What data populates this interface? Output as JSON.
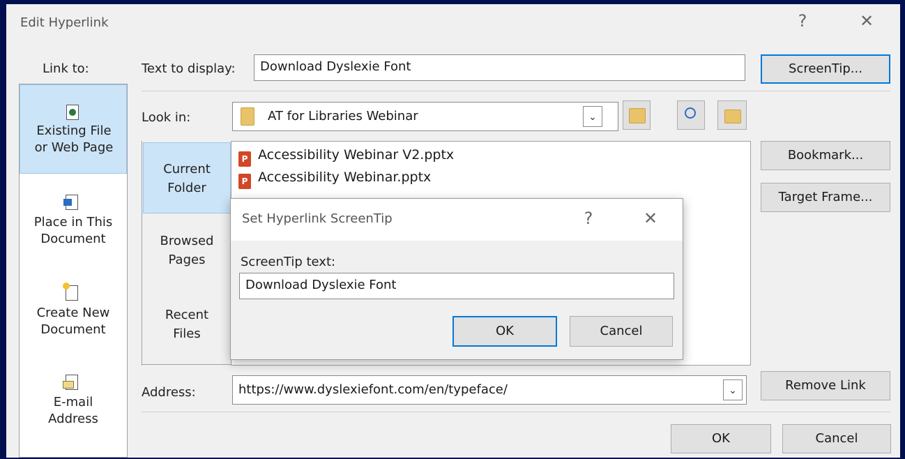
{
  "dialog": {
    "title": "Edit Hyperlink",
    "help_btn": "?",
    "close_btn": "✕",
    "link_to_label": "Link to:",
    "link_items": [
      {
        "pre": "",
        "u": "",
        "post": "",
        "line1": "Existing File",
        "line2": "or Web Page"
      },
      {
        "line1": "Place in This",
        "line2": "Document"
      },
      {
        "line1": "Create New",
        "line2": "Document"
      },
      {
        "line1": "E-mail",
        "line2": "Address"
      }
    ],
    "text_to_display_label": "Text to display:",
    "text_to_display_value": "Download Dyslexie Font",
    "screentip_button": "ScreenTip...",
    "look_in_label": "Look in:",
    "look_in_value": "AT for Libraries Webinar",
    "side_tabs": [
      {
        "line1": "Current",
        "line2": "Folder"
      },
      {
        "line1": "Browsed",
        "line2": "Pages"
      },
      {
        "line1": "Recent",
        "line2": "Files"
      }
    ],
    "files": [
      "Accessibility Webinar V2.pptx",
      "Accessibility Webinar.pptx"
    ],
    "bookmark_button": "Bookmark...",
    "target_frame_button": "Target Frame...",
    "address_label": "Address:",
    "address_value": "https://www.dyslexiefont.com/en/typeface/",
    "remove_link_button": "Remove Link",
    "ok_button": "OK",
    "cancel_button": "Cancel"
  },
  "screentip_dialog": {
    "title": "Set Hyperlink ScreenTip",
    "help_btn": "?",
    "close_btn": "✕",
    "label": "ScreenTip text:",
    "value": "Download Dyslexie Font",
    "ok_button": "OK",
    "cancel_button": "Cancel"
  },
  "colors": {
    "background": "#00104f",
    "dialog": "#f0f0f0",
    "selection": "#cce4f7",
    "focus": "#0078d7"
  },
  "icons": [
    "existing-file-icon",
    "place-in-document-icon",
    "create-new-document-icon",
    "email-address-icon",
    "folder-icon",
    "up-folder-icon",
    "browse-web-icon",
    "browse-file-icon",
    "powerpoint-file-icon",
    "dropdown-arrow-icon"
  ]
}
